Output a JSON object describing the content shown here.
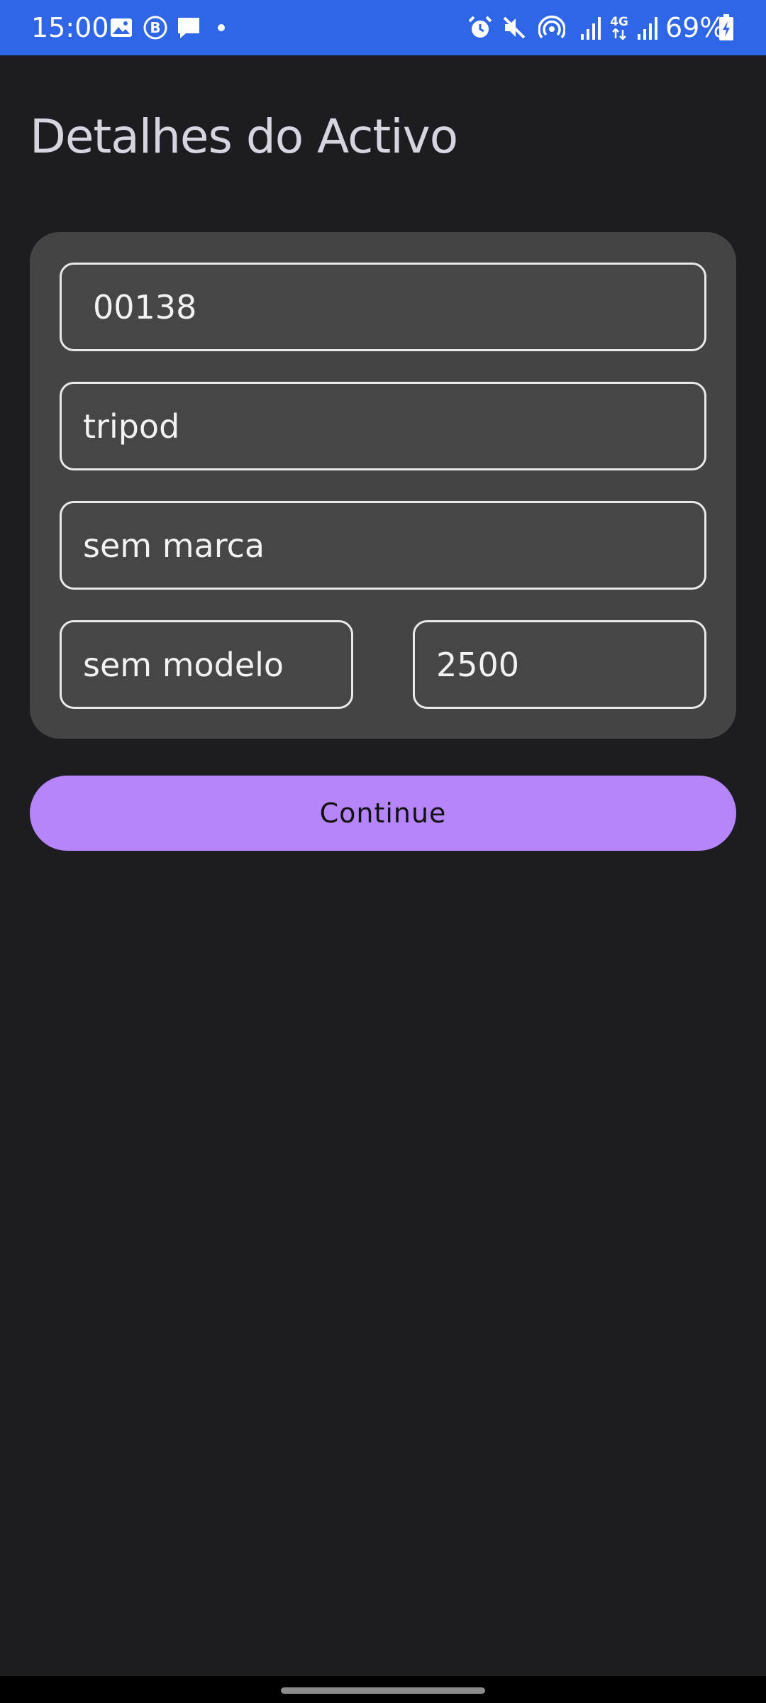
{
  "status_bar": {
    "time": "15:00",
    "battery": "69%",
    "network": "4G",
    "icons_left": [
      "gallery-icon",
      "b-badge-icon",
      "message-icon",
      "dot-icon"
    ],
    "icons_right": [
      "alarm-icon",
      "mute-icon",
      "hotspot-icon",
      "signal-icon",
      "signal-4g-icon",
      "signal-icon",
      "battery-charging-icon"
    ]
  },
  "page": {
    "title": "Detalhes do Activo"
  },
  "form": {
    "asset_id": "00138",
    "name": "tripod",
    "brand": "sem marca",
    "model": "sem modelo",
    "value": "2500"
  },
  "actions": {
    "continue_label": "Continue"
  },
  "colors": {
    "status_bar_bg": "#2f66e8",
    "background": "#1d1c21",
    "card": "#444444",
    "button": "#b685f9",
    "title": "#d6d4de"
  }
}
